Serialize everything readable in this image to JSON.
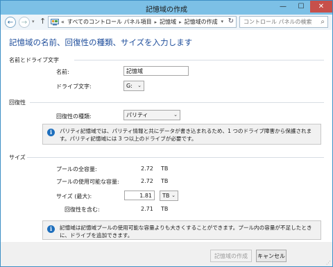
{
  "window": {
    "title": "記憶域の作成",
    "min_glyph": "—",
    "max_glyph": "☐",
    "close_glyph": "✕"
  },
  "nav": {
    "back_glyph": "←",
    "forward_glyph": "→",
    "dropdown_glyph": "▾",
    "up_glyph": "↑",
    "breadcrumbs": [
      "«",
      "すべてのコントロール パネル項目",
      "記憶域",
      "記憶域の作成"
    ],
    "separator": "▸",
    "refresh_glyph": "↻",
    "search_placeholder": "コントロール パネルの検索",
    "search_glyph": "⌕"
  },
  "page": {
    "heading": "記憶域の名前、回復性の種類、サイズを入力します"
  },
  "name_section": {
    "title": "名前とドライブ文字",
    "name_label": "名前:",
    "name_value": "記憶域",
    "drive_label": "ドライブ文字:",
    "drive_value": "G:"
  },
  "resiliency_section": {
    "title": "回復性",
    "type_label": "回復性の種類:",
    "type_value": "パリティ",
    "info_text": "パリティ記憶域では、パリティ情報と共にデータが書き込まれるため、1 つのドライブ障害から保護されます。パリティ記憶域には 3 つ以上のドライブが必要です。"
  },
  "size_section": {
    "title": "サイズ",
    "total_label": "プールの全容量:",
    "total_value": "2.72",
    "total_unit": "TB",
    "available_label": "プールの使用可能な容量:",
    "available_value": "2.72",
    "available_unit": "TB",
    "max_label": "サイズ (最大):",
    "max_value": "1.81",
    "max_unit": "TB",
    "including_label": "回復性を含む:",
    "including_value": "2.71",
    "including_unit": "TB",
    "info_text": "記憶域は記憶域プールの使用可能な容量よりも大きくすることができます。プール内の容量が不足したときに、ドライブを追加できます。"
  },
  "footer": {
    "create_label": "記憶域の作成",
    "cancel_label": "キャンセル"
  },
  "colors": {
    "accent": "#1e4d9b",
    "close": "#c7504b",
    "frame": "#7cc0e6"
  }
}
